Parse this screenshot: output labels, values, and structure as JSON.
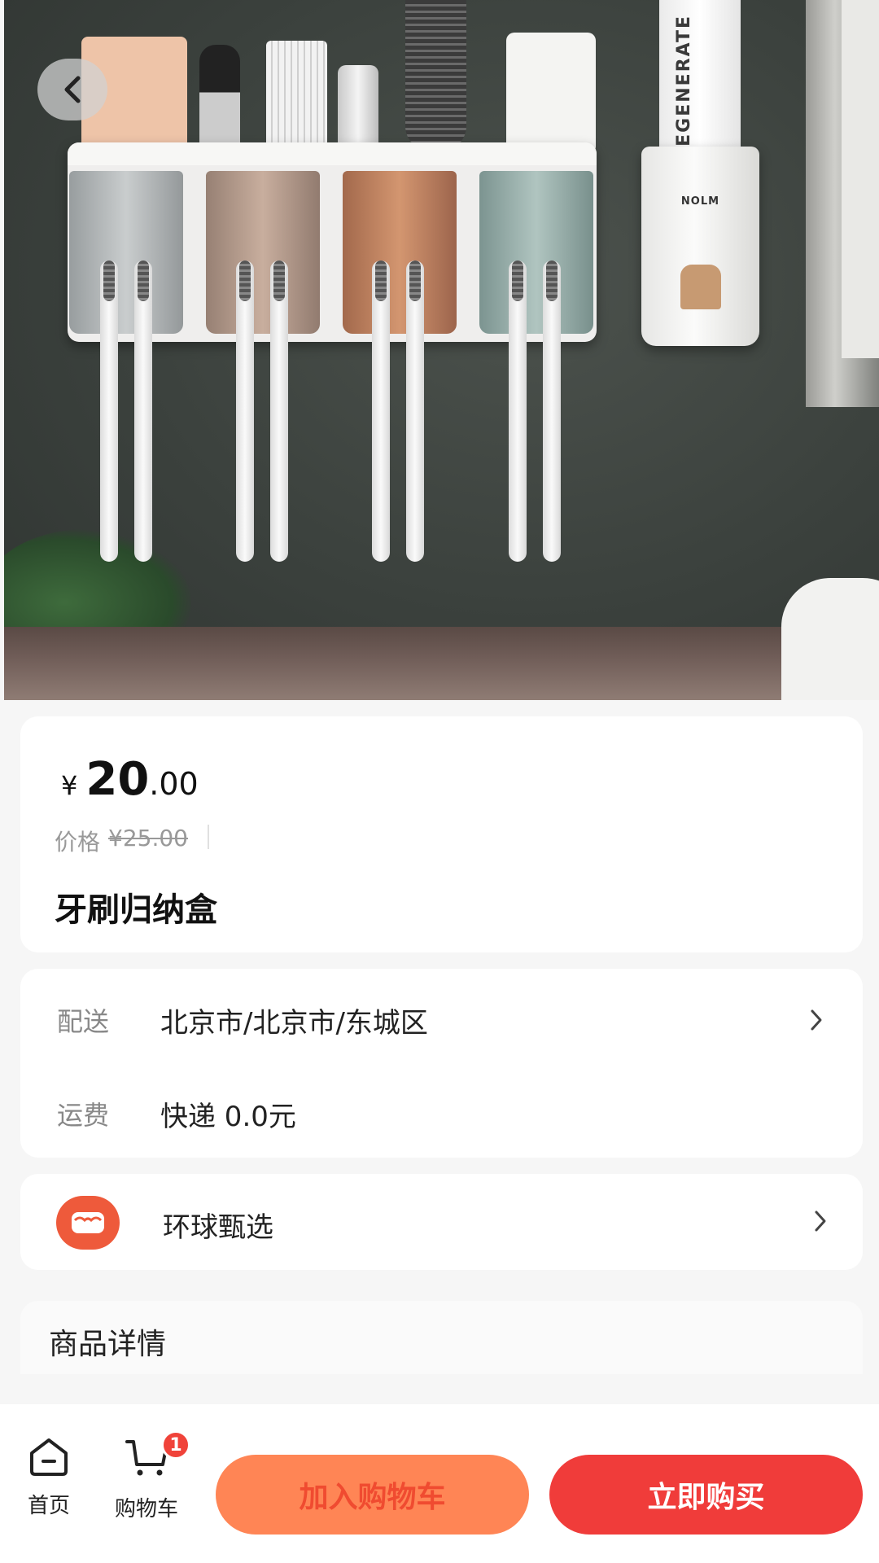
{
  "product": {
    "currency_symbol": "¥",
    "price_integer": "20",
    "price_decimal": ".00",
    "original_label": "价格",
    "original_price": "¥25.00",
    "name": "牙刷归纳盒"
  },
  "image": {
    "dispenser_brand": "NOLM",
    "toothpaste_text": "REGENERATE"
  },
  "shipping": {
    "delivery_label": "配送",
    "delivery_value": "北京市/北京市/东城区",
    "fee_label": "运费",
    "fee_value": "快递 0.0元"
  },
  "store": {
    "name": "环球甄选"
  },
  "details": {
    "title": "商品详情"
  },
  "bottom_bar": {
    "home_label": "首页",
    "cart_label": "购物车",
    "cart_count": "1",
    "add_to_cart": "加入购物车",
    "buy_now": "立即购买"
  },
  "colors": {
    "add_to_cart_bg": "#ff8555",
    "buy_now_bg": "#f03c3a",
    "badge": "#f0433a",
    "store_logo": "#ee5a3b"
  }
}
